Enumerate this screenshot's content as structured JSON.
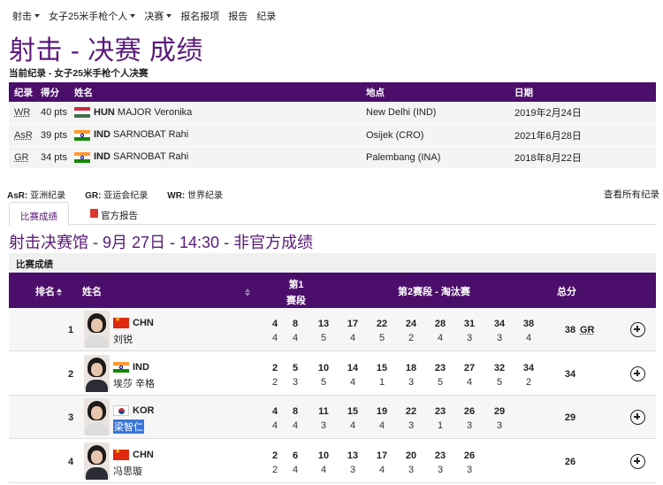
{
  "nav": {
    "items": [
      {
        "label": "射击",
        "dropdown": true
      },
      {
        "label": "女子25米手枪个人",
        "dropdown": true
      },
      {
        "label": "决赛",
        "dropdown": true
      },
      {
        "label": "报名报项",
        "dropdown": false
      },
      {
        "label": "报告",
        "dropdown": false
      },
      {
        "label": "纪录",
        "dropdown": false
      }
    ]
  },
  "page": {
    "title": "射击 - 决赛 成绩",
    "record_subtitle": "当前纪录 - 女子25米手枪个人决赛"
  },
  "records": {
    "headers": [
      "纪录",
      "得分",
      "姓名",
      "地点",
      "日期"
    ],
    "rows": [
      {
        "type": "WR",
        "score": "40 pts",
        "noc": "HUN",
        "name": "MAJOR Veronika",
        "flag": "hun",
        "place": "New Delhi (IND)",
        "date": "2019年2月24日"
      },
      {
        "type": "AsR",
        "score": "39 pts",
        "noc": "IND",
        "name": "SARNOBAT Rahi",
        "flag": "ind",
        "place": "Osijek (CRO)",
        "date": "2021年6月28日"
      },
      {
        "type": "GR",
        "score": "34 pts",
        "noc": "IND",
        "name": "SARNOBAT Rahi",
        "flag": "ind",
        "place": "Palembang (INA)",
        "date": "2018年8月22日"
      }
    ]
  },
  "legend": {
    "items": [
      {
        "abbr": "AsR:",
        "text": "亚洲纪录"
      },
      {
        "abbr": "GR:",
        "text": "亚运会纪录"
      },
      {
        "abbr": "WR:",
        "text": "世界纪录"
      }
    ],
    "see_all": "查看所有纪录"
  },
  "tabs": {
    "results": "比赛成绩",
    "official_report": "官方报告"
  },
  "venue_line": "射击决赛馆 - 9月 27日 - 14:30 - 非官方成绩",
  "results": {
    "section_label": "比赛成绩",
    "headers": {
      "rank": "排名",
      "name": "姓名",
      "stage1_line1": "第1",
      "stage1_line2": "赛段",
      "stage2": "第2赛段 - 淘汰赛",
      "total": "总分"
    },
    "rows": [
      {
        "rank": "1",
        "noc": "CHN",
        "flag": "chn",
        "name": "刘锐",
        "cumulative": [
          "4",
          "8",
          "13",
          "17",
          "22",
          "24",
          "28",
          "31",
          "34",
          "38"
        ],
        "series": [
          "4",
          "4",
          "5",
          "4",
          "5",
          "2",
          "4",
          "3",
          "3",
          "4"
        ],
        "total": "38",
        "record": "GR"
      },
      {
        "rank": "2",
        "noc": "IND",
        "flag": "ind",
        "name": "埃莎 辛格",
        "cumulative": [
          "2",
          "5",
          "10",
          "14",
          "15",
          "18",
          "23",
          "27",
          "32",
          "34"
        ],
        "series": [
          "2",
          "3",
          "5",
          "4",
          "1",
          "3",
          "5",
          "4",
          "5",
          "2"
        ],
        "total": "34",
        "record": ""
      },
      {
        "rank": "3",
        "noc": "KOR",
        "flag": "kor",
        "name": "梁智仁",
        "cumulative": [
          "4",
          "8",
          "11",
          "15",
          "19",
          "22",
          "23",
          "26",
          "29"
        ],
        "series": [
          "4",
          "4",
          "3",
          "4",
          "4",
          "3",
          "1",
          "3",
          "3"
        ],
        "total": "29",
        "record": ""
      },
      {
        "rank": "4",
        "noc": "CHN",
        "flag": "chn",
        "name": "冯思璇",
        "cumulative": [
          "2",
          "6",
          "10",
          "13",
          "17",
          "20",
          "23",
          "26"
        ],
        "series": [
          "2",
          "4",
          "4",
          "3",
          "4",
          "3",
          "3",
          "3"
        ],
        "total": "26",
        "record": ""
      }
    ]
  }
}
